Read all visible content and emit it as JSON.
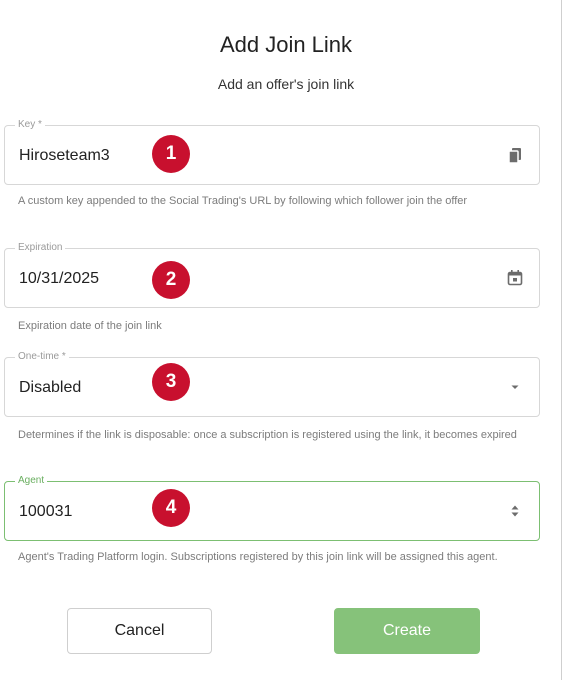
{
  "dialog": {
    "title": "Add Join Link",
    "subtitle": "Add an offer's join link"
  },
  "fields": {
    "key": {
      "label": "Key *",
      "value": "Hiroseteam3",
      "helper": "A custom key appended to the Social Trading's URL by following which follower join the offer",
      "icon": "copy-icon"
    },
    "expiration": {
      "label": "Expiration",
      "value": "10/31/2025",
      "helper": "Expiration date of the join link",
      "icon": "calendar-icon"
    },
    "one_time": {
      "label": "One-time *",
      "value": "Disabled",
      "helper": "Determines if the link is disposable: once a subscription is registered using the link, it becomes expired",
      "icon": "dropdown-arrow-icon"
    },
    "agent": {
      "label": "Agent",
      "value": "100031",
      "helper": "Agent's Trading Platform login. Subscriptions registered by this join link will be assigned this agent.",
      "icon": "stepper-icon"
    }
  },
  "badges": [
    "1",
    "2",
    "3",
    "4"
  ],
  "buttons": {
    "cancel": "Cancel",
    "create": "Create"
  },
  "colors": {
    "badge": "#c8102e",
    "create_button": "#86c27a",
    "focus_border": "#7cbf72"
  }
}
